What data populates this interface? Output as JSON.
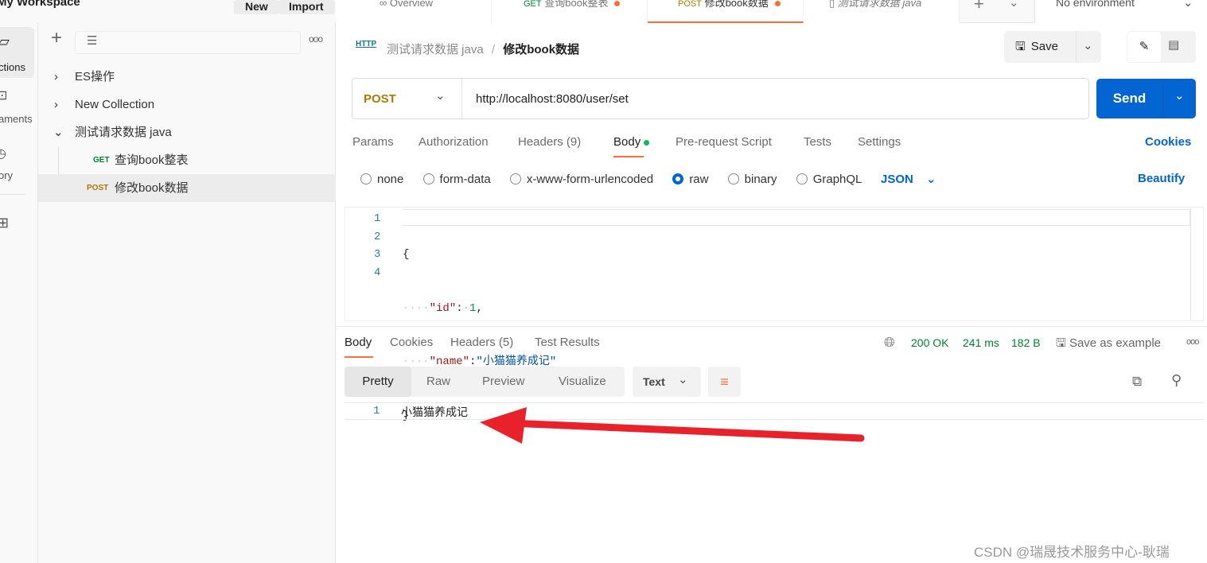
{
  "header": {
    "workspace": "My Workspace",
    "new_label": "New",
    "import_label": "Import",
    "environment": "No environment"
  },
  "tabs": [
    {
      "label": "Overview"
    },
    {
      "method": "GET",
      "label": "查询book整表"
    },
    {
      "method": "POST",
      "label": "修改book数据"
    },
    {
      "label": "测试请求数据 java"
    }
  ],
  "rail": {
    "items": [
      {
        "label": "ctions"
      },
      {
        "label": "aments"
      },
      {
        "label": "ory"
      }
    ]
  },
  "sidebar": {
    "items": [
      {
        "label": "ES操作"
      },
      {
        "label": "New Collection"
      },
      {
        "label": "测试请求数据 java"
      }
    ],
    "requests": [
      {
        "method": "GET",
        "label": "查询book整表"
      },
      {
        "method": "POST",
        "label": "修改book数据"
      }
    ]
  },
  "breadcrumb": {
    "parent": "测试请求数据 java",
    "sep": "/",
    "current": "修改book数据"
  },
  "actions": {
    "save": "Save"
  },
  "request": {
    "method": "POST",
    "url": "http://localhost:8080/user/set",
    "send": "Send"
  },
  "request_tabs": [
    "Params",
    "Authorization",
    "Headers (9)",
    "Body",
    "Pre-request Script",
    "Tests",
    "Settings"
  ],
  "cookies": "Cookies",
  "body_types": [
    "none",
    "form-data",
    "x-www-form-urlencoded",
    "raw",
    "binary",
    "GraphQL"
  ],
  "body_format": "JSON",
  "beautify": "Beautify",
  "editor": {
    "lines": [
      "1",
      "2",
      "3",
      "4"
    ],
    "l1": "{",
    "l2_key": "\"id\"",
    "l2_val": "1",
    "l3_key": "\"name\"",
    "l3_val": "\"小猫猫养成记\"",
    "l4": "}"
  },
  "response": {
    "tabs": [
      "Body",
      "Cookies",
      "Headers (5)",
      "Test Results"
    ],
    "status": "200 OK",
    "time": "241 ms",
    "size": "182 B",
    "save_example": "Save as example",
    "views": [
      "Pretty",
      "Raw",
      "Preview",
      "Visualize"
    ],
    "format": "Text",
    "line": "1",
    "content": "小猫猫养成记"
  },
  "watermark": "CSDN @瑞晟技术服务中心-耿瑞",
  "colors": {
    "accent": "#ff6c37",
    "send": "#0265d2",
    "post": "#ad7a03",
    "get": "#007f31",
    "arrow": "#e8212b"
  }
}
